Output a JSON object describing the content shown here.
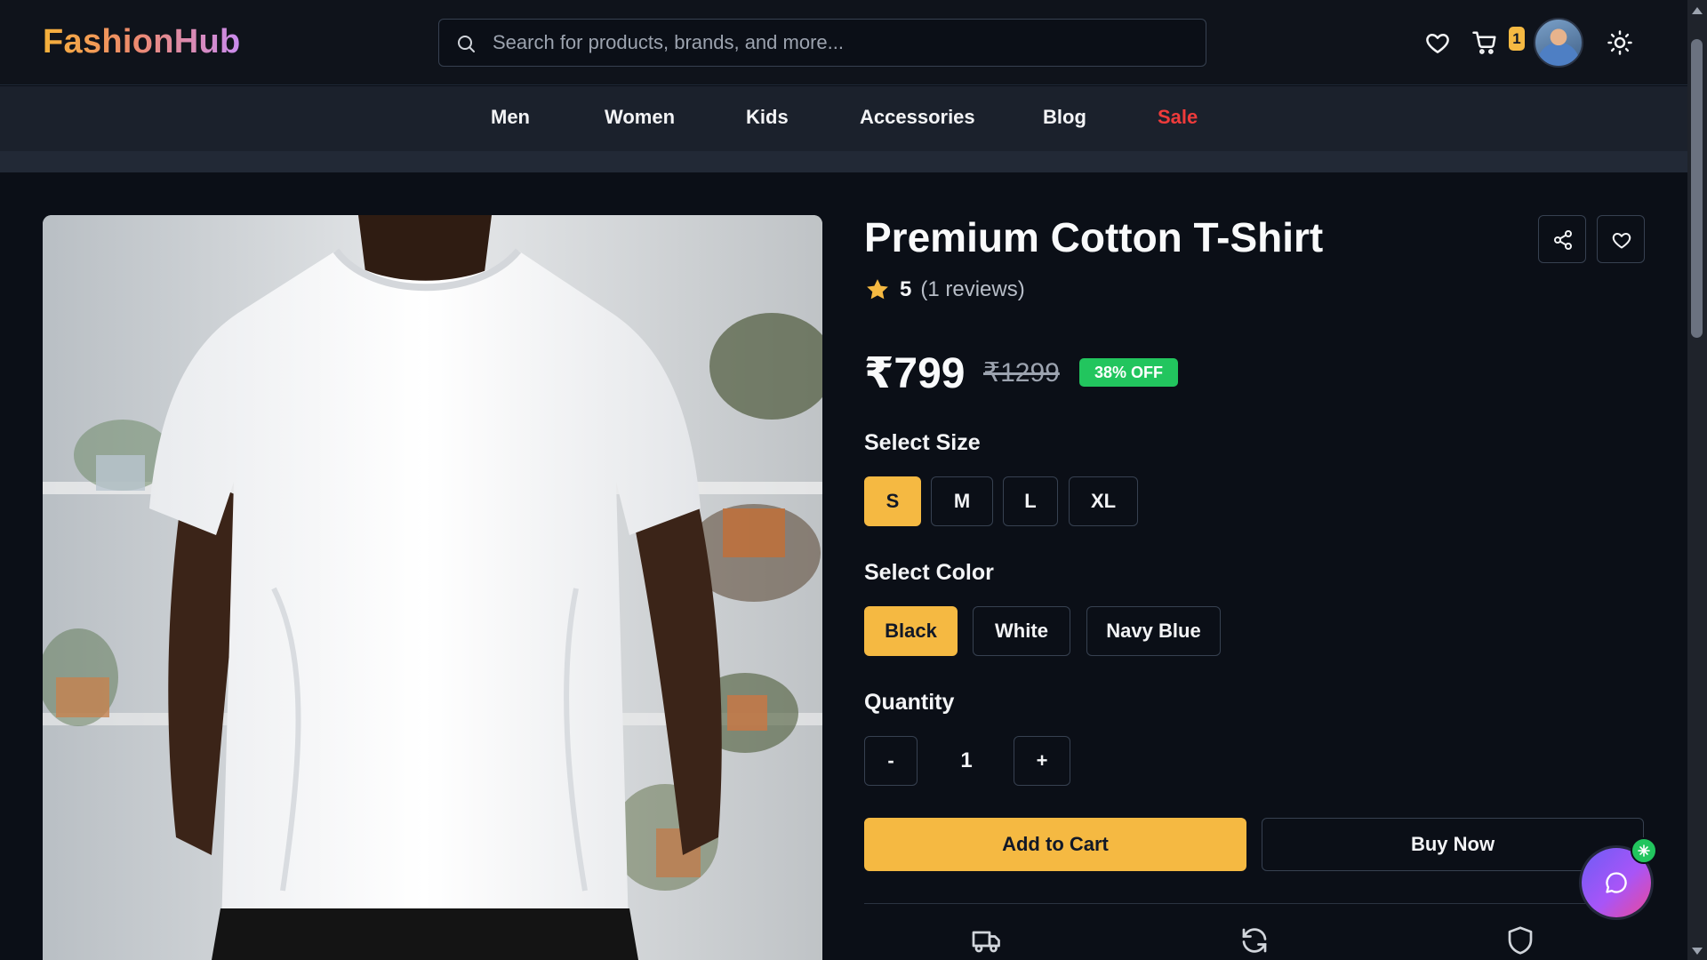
{
  "header": {
    "logo": "FashionHub",
    "search_placeholder": "Search for products, brands, and more...",
    "cart_count": "1",
    "icons": [
      "heart-icon",
      "cart-icon",
      "sun-icon"
    ]
  },
  "nav": {
    "items": [
      "Men",
      "Women",
      "Kids",
      "Accessories",
      "Blog",
      "Sale"
    ]
  },
  "product": {
    "title": "Premium Cotton T-Shirt",
    "rating": "5",
    "reviews": "(1 reviews)",
    "price": "₹799",
    "old_price": "₹1299",
    "discount": "38% OFF",
    "size_label": "Select Size",
    "sizes": [
      "S",
      "M",
      "L",
      "XL"
    ],
    "selected_size": "S",
    "color_label": "Select Color",
    "colors": [
      "Black",
      "White",
      "Navy Blue"
    ],
    "selected_color": "Black",
    "quantity_label": "Quantity",
    "quantity": "1",
    "qty_minus": "-",
    "qty_plus": "+",
    "add_to_cart": "Add to Cart",
    "buy_now": "Buy Now"
  },
  "theme": {
    "accent": "#f5b942",
    "sale": "#ef3b3b",
    "discount_badge": "#22c55e",
    "background": "#0b0f17"
  }
}
